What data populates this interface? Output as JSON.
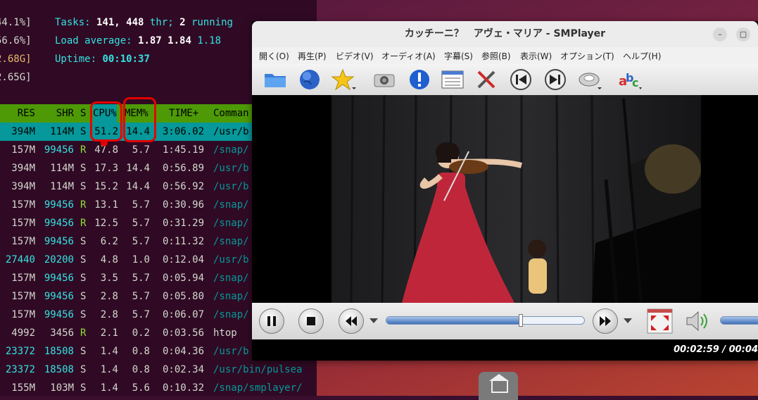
{
  "htop": {
    "tasks_label": "Tasks:",
    "tasks_count": "141,",
    "threads": "448",
    "thr_label": "thr;",
    "running_count": "2",
    "running_label": "running",
    "load_label": "Load average:",
    "load_1": "1.87",
    "load_5": "1.84",
    "load_15": "1.18",
    "uptime_label": "Uptime:",
    "uptime": "00:10:37",
    "meter_lines": [
      "44.1%]",
      "56.6%]",
      "2.68G]",
      "2.65G]"
    ],
    "columns": [
      "RES",
      "SHR",
      "S",
      "CPU%",
      "MEM%",
      "TIME+",
      "Comman"
    ],
    "rows": [
      {
        "res": "394M",
        "shr": "114M",
        "s": "S",
        "cpu": "51.2",
        "mem": "14.4",
        "time": "3:06.02",
        "cmd": "/usr/b"
      },
      {
        "res": "157M",
        "shr": "99456",
        "s": "R",
        "cpu": "47.8",
        "mem": "5.7",
        "time": "1:45.19",
        "cmd": "/snap/"
      },
      {
        "res": "394M",
        "shr": "114M",
        "s": "S",
        "cpu": "17.3",
        "mem": "14.4",
        "time": "0:56.89",
        "cmd": "/usr/b"
      },
      {
        "res": "394M",
        "shr": "114M",
        "s": "S",
        "cpu": "15.2",
        "mem": "14.4",
        "time": "0:56.92",
        "cmd": "/usr/b"
      },
      {
        "res": "157M",
        "shr": "99456",
        "s": "R",
        "cpu": "13.1",
        "mem": "5.7",
        "time": "0:30.96",
        "cmd": "/snap/"
      },
      {
        "res": "157M",
        "shr": "99456",
        "s": "R",
        "cpu": "12.5",
        "mem": "5.7",
        "time": "0:31.29",
        "cmd": "/snap/"
      },
      {
        "res": "157M",
        "shr": "99456",
        "s": "S",
        "cpu": "6.2",
        "mem": "5.7",
        "time": "0:11.32",
        "cmd": "/snap/"
      },
      {
        "res": "27440",
        "shr": "20200",
        "s": "S",
        "cpu": "4.8",
        "mem": "1.0",
        "time": "0:12.04",
        "cmd": "/usr/b"
      },
      {
        "res": "157M",
        "shr": "99456",
        "s": "S",
        "cpu": "3.5",
        "mem": "5.7",
        "time": "0:05.94",
        "cmd": "/snap/"
      },
      {
        "res": "157M",
        "shr": "99456",
        "s": "S",
        "cpu": "2.8",
        "mem": "5.7",
        "time": "0:05.80",
        "cmd": "/snap/"
      },
      {
        "res": "157M",
        "shr": "99456",
        "s": "S",
        "cpu": "2.8",
        "mem": "5.7",
        "time": "0:06.07",
        "cmd": "/snap/"
      },
      {
        "res": "4992",
        "shr": "3456",
        "s": "R",
        "cpu": "2.1",
        "mem": "0.2",
        "time": "0:03.56",
        "cmd": "htop"
      },
      {
        "res": "23372",
        "shr": "18508",
        "s": "S",
        "cpu": "1.4",
        "mem": "0.8",
        "time": "0:04.36",
        "cmd": "/usr/b"
      },
      {
        "res": "23372",
        "shr": "18508",
        "s": "S",
        "cpu": "1.4",
        "mem": "0.8",
        "time": "0:02.34",
        "cmd": "/usr/bin/pulsea"
      },
      {
        "res": "155M",
        "shr": "103M",
        "s": "S",
        "cpu": "1.4",
        "mem": "5.6",
        "time": "0:10.32",
        "cmd": "/snap/smplayer/"
      }
    ]
  },
  "smplayer": {
    "title": "カッチーニ？　アヴェ・マリア - SMPlayer",
    "menu": [
      "開く(O)",
      "再生(P)",
      "ビデオ(V)",
      "オーディオ(A)",
      "字幕(S)",
      "参照(B)",
      "表示(W)",
      "オプション(T)",
      "ヘルプ(H)"
    ],
    "seek_progress": 0.68,
    "time": "00:02:59 / 00:04"
  },
  "colors": {
    "terminal_bg": "#300a24",
    "highlight": "#e50000",
    "selection": "#06989a"
  }
}
